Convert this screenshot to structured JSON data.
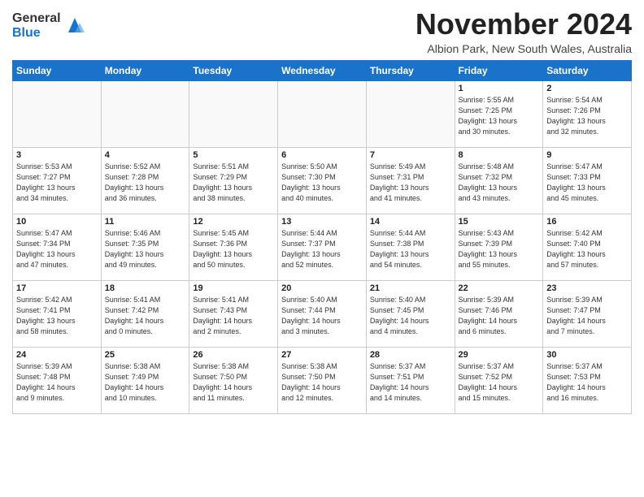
{
  "logo": {
    "general": "General",
    "blue": "Blue"
  },
  "header": {
    "month": "November 2024",
    "location": "Albion Park, New South Wales, Australia"
  },
  "weekdays": [
    "Sunday",
    "Monday",
    "Tuesday",
    "Wednesday",
    "Thursday",
    "Friday",
    "Saturday"
  ],
  "weeks": [
    [
      {
        "day": "",
        "info": "",
        "empty": true
      },
      {
        "day": "",
        "info": "",
        "empty": true
      },
      {
        "day": "",
        "info": "",
        "empty": true
      },
      {
        "day": "",
        "info": "",
        "empty": true
      },
      {
        "day": "",
        "info": "",
        "empty": true
      },
      {
        "day": "1",
        "info": "Sunrise: 5:55 AM\nSunset: 7:25 PM\nDaylight: 13 hours\nand 30 minutes."
      },
      {
        "day": "2",
        "info": "Sunrise: 5:54 AM\nSunset: 7:26 PM\nDaylight: 13 hours\nand 32 minutes."
      }
    ],
    [
      {
        "day": "3",
        "info": "Sunrise: 5:53 AM\nSunset: 7:27 PM\nDaylight: 13 hours\nand 34 minutes."
      },
      {
        "day": "4",
        "info": "Sunrise: 5:52 AM\nSunset: 7:28 PM\nDaylight: 13 hours\nand 36 minutes."
      },
      {
        "day": "5",
        "info": "Sunrise: 5:51 AM\nSunset: 7:29 PM\nDaylight: 13 hours\nand 38 minutes."
      },
      {
        "day": "6",
        "info": "Sunrise: 5:50 AM\nSunset: 7:30 PM\nDaylight: 13 hours\nand 40 minutes."
      },
      {
        "day": "7",
        "info": "Sunrise: 5:49 AM\nSunset: 7:31 PM\nDaylight: 13 hours\nand 41 minutes."
      },
      {
        "day": "8",
        "info": "Sunrise: 5:48 AM\nSunset: 7:32 PM\nDaylight: 13 hours\nand 43 minutes."
      },
      {
        "day": "9",
        "info": "Sunrise: 5:47 AM\nSunset: 7:33 PM\nDaylight: 13 hours\nand 45 minutes."
      }
    ],
    [
      {
        "day": "10",
        "info": "Sunrise: 5:47 AM\nSunset: 7:34 PM\nDaylight: 13 hours\nand 47 minutes."
      },
      {
        "day": "11",
        "info": "Sunrise: 5:46 AM\nSunset: 7:35 PM\nDaylight: 13 hours\nand 49 minutes."
      },
      {
        "day": "12",
        "info": "Sunrise: 5:45 AM\nSunset: 7:36 PM\nDaylight: 13 hours\nand 50 minutes."
      },
      {
        "day": "13",
        "info": "Sunrise: 5:44 AM\nSunset: 7:37 PM\nDaylight: 13 hours\nand 52 minutes."
      },
      {
        "day": "14",
        "info": "Sunrise: 5:44 AM\nSunset: 7:38 PM\nDaylight: 13 hours\nand 54 minutes."
      },
      {
        "day": "15",
        "info": "Sunrise: 5:43 AM\nSunset: 7:39 PM\nDaylight: 13 hours\nand 55 minutes."
      },
      {
        "day": "16",
        "info": "Sunrise: 5:42 AM\nSunset: 7:40 PM\nDaylight: 13 hours\nand 57 minutes."
      }
    ],
    [
      {
        "day": "17",
        "info": "Sunrise: 5:42 AM\nSunset: 7:41 PM\nDaylight: 13 hours\nand 58 minutes."
      },
      {
        "day": "18",
        "info": "Sunrise: 5:41 AM\nSunset: 7:42 PM\nDaylight: 14 hours\nand 0 minutes."
      },
      {
        "day": "19",
        "info": "Sunrise: 5:41 AM\nSunset: 7:43 PM\nDaylight: 14 hours\nand 2 minutes."
      },
      {
        "day": "20",
        "info": "Sunrise: 5:40 AM\nSunset: 7:44 PM\nDaylight: 14 hours\nand 3 minutes."
      },
      {
        "day": "21",
        "info": "Sunrise: 5:40 AM\nSunset: 7:45 PM\nDaylight: 14 hours\nand 4 minutes."
      },
      {
        "day": "22",
        "info": "Sunrise: 5:39 AM\nSunset: 7:46 PM\nDaylight: 14 hours\nand 6 minutes."
      },
      {
        "day": "23",
        "info": "Sunrise: 5:39 AM\nSunset: 7:47 PM\nDaylight: 14 hours\nand 7 minutes."
      }
    ],
    [
      {
        "day": "24",
        "info": "Sunrise: 5:39 AM\nSunset: 7:48 PM\nDaylight: 14 hours\nand 9 minutes."
      },
      {
        "day": "25",
        "info": "Sunrise: 5:38 AM\nSunset: 7:49 PM\nDaylight: 14 hours\nand 10 minutes."
      },
      {
        "day": "26",
        "info": "Sunrise: 5:38 AM\nSunset: 7:50 PM\nDaylight: 14 hours\nand 11 minutes."
      },
      {
        "day": "27",
        "info": "Sunrise: 5:38 AM\nSunset: 7:50 PM\nDaylight: 14 hours\nand 12 minutes."
      },
      {
        "day": "28",
        "info": "Sunrise: 5:37 AM\nSunset: 7:51 PM\nDaylight: 14 hours\nand 14 minutes."
      },
      {
        "day": "29",
        "info": "Sunrise: 5:37 AM\nSunset: 7:52 PM\nDaylight: 14 hours\nand 15 minutes."
      },
      {
        "day": "30",
        "info": "Sunrise: 5:37 AM\nSunset: 7:53 PM\nDaylight: 14 hours\nand 16 minutes."
      }
    ]
  ]
}
